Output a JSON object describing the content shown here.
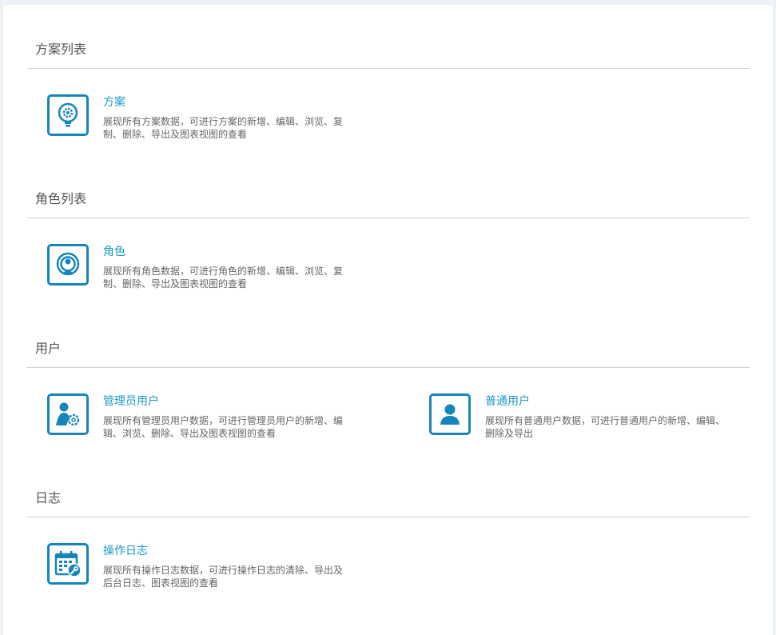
{
  "colors": {
    "accent": "#1686ba",
    "title": "#1c9ac9",
    "text": "#666666",
    "heading": "#555555",
    "divider": "#cfd2d6"
  },
  "sections": [
    {
      "title": "方案列表",
      "items": [
        {
          "icon": "lightbulb-gear-icon",
          "title": "方案",
          "desc": "展现所有方案数据，可进行方案的新增、编辑、浏览、复制、删除、导出及图表视图的查看"
        }
      ]
    },
    {
      "title": "角色列表",
      "items": [
        {
          "icon": "role-broadcast-icon",
          "title": "角色",
          "desc": "展现所有角色数据，可进行角色的新增、编辑、浏览、复制、删除、导出及图表视图的查看"
        }
      ]
    },
    {
      "title": "用户",
      "items": [
        {
          "icon": "admin-user-gear-icon",
          "title": "管理员用户",
          "desc": "展现所有管理员用户数据，可进行管理员用户的新增、编辑、浏览、删除、导出及图表视图的查看"
        },
        {
          "icon": "user-icon",
          "title": "普通用户",
          "desc": "展现所有普通用户数据，可进行普通用户的新增、编辑、删除及导出"
        }
      ]
    },
    {
      "title": "日志",
      "items": [
        {
          "icon": "calendar-wrench-icon",
          "title": "操作日志",
          "desc": "展现所有操作日志数据，可进行操作日志的清除、导出及后台日志、图表视图的查看"
        }
      ]
    }
  ]
}
